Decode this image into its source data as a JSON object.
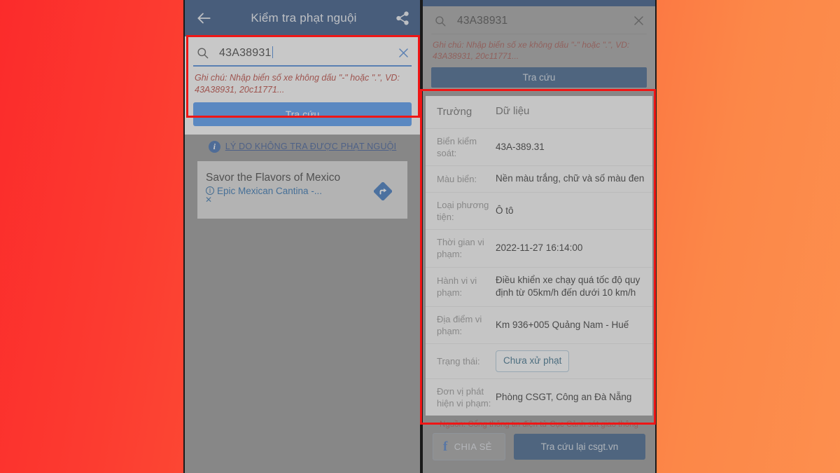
{
  "background": {
    "from": "#fb2b2b",
    "to": "#fd8f4e"
  },
  "accent": {
    "blue": "#1f4478",
    "button_blue": "#3f8ef0",
    "dark_blue": "#2b527f",
    "annotation_red": "#ef1616"
  },
  "left_phone": {
    "appbar": {
      "back_icon": "arrow-left-icon",
      "title": "Kiểm tra phạt nguội",
      "share_icon": "share-icon"
    },
    "search": {
      "search_icon": "search-icon",
      "value": "43A38931",
      "placeholder": "43A38931",
      "clear_icon": "close-icon"
    },
    "note": "Ghi chú: Nhập biển số xe không dấu \"-\" hoặc \".\", VD: 43A38931, 20c11771...",
    "lookup_button": "Tra cứu",
    "reason": {
      "info_icon": "info-icon",
      "link": "LÝ DO KHÔNG TRA ĐƯỢC PHẠT NGUỘI"
    },
    "ad": {
      "title": "Savor the Flavors of Mexico",
      "info_icon": "ad-info-icon",
      "subtitle": "Epic Mexican Cantina -...",
      "close_icon": "ad-close-icon",
      "action_icon": "directions-arrow-icon"
    }
  },
  "right_phone": {
    "search": {
      "search_icon": "search-icon",
      "value": "43A38931",
      "placeholder": "43A38931",
      "clear_icon": "close-icon"
    },
    "note": "Ghi chú: Nhập biển số xe không dấu \"-\" hoặc \".\", VD: 43A38931, 20c11771...",
    "lookup_button": "Tra cứu",
    "table": {
      "headers": [
        "Trường",
        "Dữ liệu"
      ],
      "rows": [
        {
          "field": "Biển kiểm soát:",
          "value": "43A-389.31"
        },
        {
          "field": "Màu biển:",
          "value": "Nền màu trắng, chữ và số màu đen"
        },
        {
          "field": "Loại phương tiện:",
          "value": "Ô tô"
        },
        {
          "field": "Thời gian vi phạm:",
          "value": "2022-11-27 16:14:00"
        },
        {
          "field": "Hành vi vi phạm:",
          "value": "Điều khiển xe chạy quá tốc độ quy định từ 05km/h đến dưới 10 km/h"
        },
        {
          "field": "Địa điểm vi phạm:",
          "value": "Km 936+005 Quảng Nam - Huế"
        },
        {
          "field": "Trạng thái:",
          "value": "Chưa xử phạt",
          "is_chip": true
        },
        {
          "field": "Đơn vị phát hiện vi phạm:",
          "value": "Phòng CSGT, Công an  Đà Nẵng"
        }
      ]
    },
    "source": "Nguồn: Cổng thông tin điện tử Cục Cảnh sát giao thông",
    "share_button": {
      "icon": "facebook-icon",
      "label": "CHIA SẺ"
    },
    "again_button": "Tra cứu lại csgt.vn"
  },
  "annotations": {
    "left_search_box": "highlight-left-search-area",
    "right_table_box": "highlight-right-result-table"
  }
}
